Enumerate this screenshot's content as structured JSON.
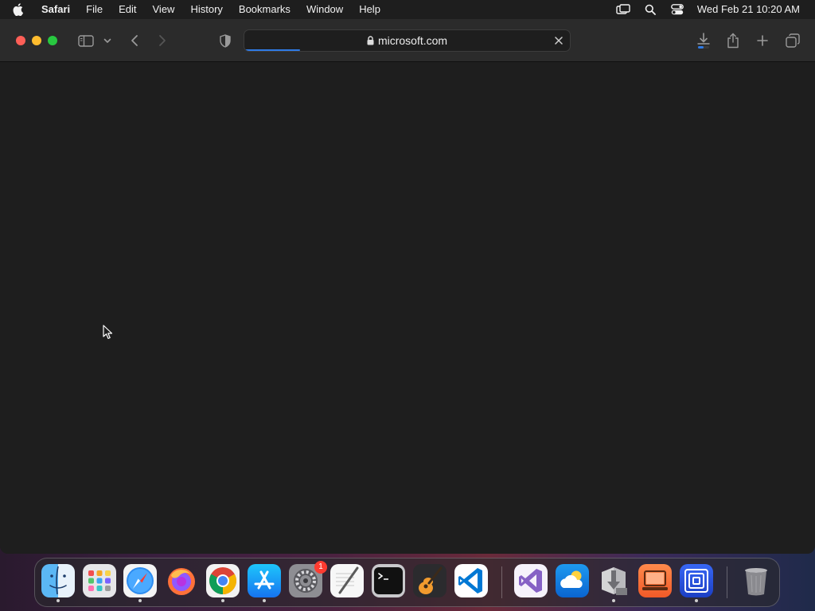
{
  "menubar": {
    "app_name": "Safari",
    "items": [
      "File",
      "Edit",
      "View",
      "History",
      "Bookmarks",
      "Window",
      "Help"
    ],
    "clock": "Wed Feb 21  10:20 AM"
  },
  "browser": {
    "url": "microsoft.com",
    "load_progress": 0.17,
    "page_background": "#1e1e1e"
  },
  "dock": {
    "apps": [
      {
        "name": "Finder",
        "icon": "finder-icon",
        "running": true
      },
      {
        "name": "Launchpad",
        "icon": "launchpad-icon",
        "running": false
      },
      {
        "name": "Safari",
        "icon": "safari-icon",
        "running": true
      },
      {
        "name": "Firefox",
        "icon": "firefox-icon",
        "running": false
      },
      {
        "name": "Google Chrome",
        "icon": "chrome-icon",
        "running": true
      },
      {
        "name": "App Store",
        "icon": "app-store-icon",
        "running": true
      },
      {
        "name": "System Settings",
        "icon": "system-settings-icon",
        "running": false,
        "badge": "1"
      },
      {
        "name": "TextEdit",
        "icon": "textedit-icon",
        "running": false
      },
      {
        "name": "Terminal",
        "icon": "terminal-icon",
        "running": false
      },
      {
        "name": "GarageBand",
        "icon": "garageband-icon",
        "running": false
      },
      {
        "name": "Visual Studio Code",
        "icon": "vscode-icon",
        "running": false
      },
      {
        "name": "Visual Studio",
        "icon": "visual-studio-icon",
        "running": false
      },
      {
        "name": "Weather",
        "icon": "weather-icon",
        "running": false
      },
      {
        "name": "Installer",
        "icon": "installer-icon",
        "running": true
      },
      {
        "name": "Remote Desktop",
        "icon": "remote-desktop-icon",
        "running": false
      },
      {
        "name": "Screen Sharing",
        "icon": "screen-sharing-icon",
        "running": true
      },
      {
        "name": "Trash",
        "icon": "trash-icon",
        "running": false
      }
    ]
  },
  "colors": {
    "accent": "#2f7be6",
    "close": "#fe5f57",
    "minimize": "#febc2e",
    "zoom": "#28c840",
    "badge": "#ff3b30"
  }
}
